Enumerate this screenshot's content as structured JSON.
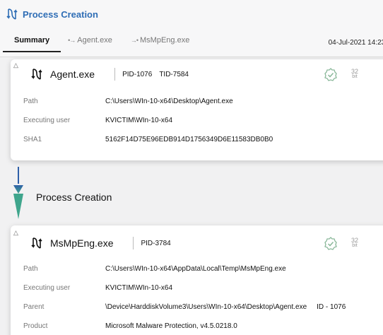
{
  "header": {
    "title": "Process Creation"
  },
  "tabs": [
    {
      "label": "Summary"
    },
    {
      "label": "Agent.exe"
    },
    {
      "label": "MsMpEng.exe"
    }
  ],
  "datestamp": "04-Jul-2021 14:23:",
  "process1": {
    "name": "Agent.exe",
    "pid": "PID-1076",
    "tid": "TID-7584",
    "bits": "32",
    "bits_unit": "bit",
    "rows": [
      {
        "label": "Path",
        "value": "C:\\Users\\WIn-10-x64\\Desktop\\Agent.exe"
      },
      {
        "label": "Executing user",
        "value": "KVICTIM\\WIn-10-x64"
      },
      {
        "label": "SHA1",
        "value": "5162F14D75E96EDB914D1756349D6E11583DB0B0"
      }
    ]
  },
  "connector_title": "Process Creation",
  "process2": {
    "name": "MsMpEng.exe",
    "pid": "PID-3784",
    "bits": "32",
    "bits_unit": "bit",
    "rows": [
      {
        "label": "Path",
        "value": "C:\\Users\\WIn-10-x64\\AppData\\Local\\Temp\\MsMpEng.exe"
      },
      {
        "label": "Executing user",
        "value": "KVICTIM\\WIn-10-x64"
      },
      {
        "label": "Parent",
        "value": "\\Device\\HarddiskVolume3\\Users\\WIn-10-x64\\Desktop\\Agent.exe",
        "extra": "ID - 1076"
      },
      {
        "label": "Product",
        "value": "Microsoft Malware Protection, v4.5.0218.0"
      }
    ]
  },
  "colors": {
    "accent": "#2e6db5",
    "shield": "#8ab89a",
    "connector_top": "#2e5fa8",
    "connector_bottom": "#3fa58c"
  },
  "icons": {
    "process": "process-fork-icon",
    "trusted": "shield-check-icon",
    "collapse": "triangle-up-icon"
  }
}
